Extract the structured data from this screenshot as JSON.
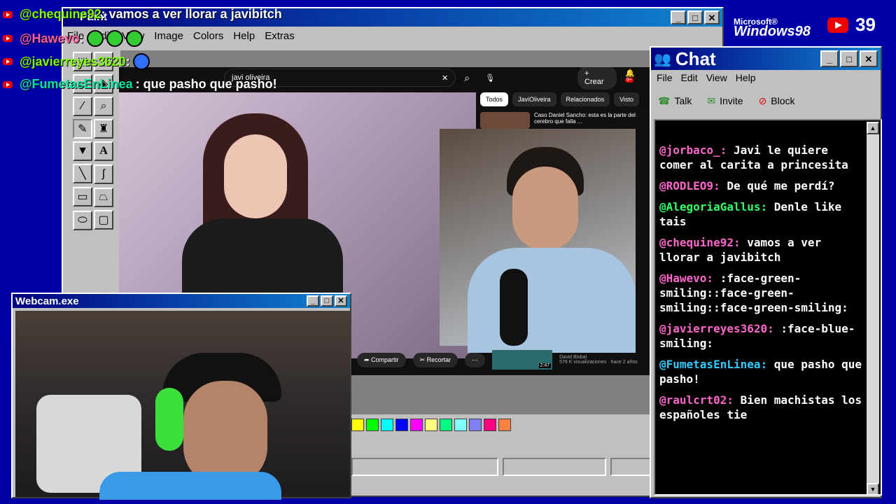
{
  "overlay_chat": [
    {
      "user": "@chequine92",
      "text": ": vamos a ver llorar a javibitch",
      "color": "#7cfc00"
    },
    {
      "user": "@Hawevo",
      "text": ":",
      "color": "#ff5fa0"
    },
    {
      "user": "@javierreyes3620",
      "text": ":",
      "color": "#7cfc00"
    },
    {
      "user": "@FumetasEnLinea",
      "text": ": que pasho que pasho!",
      "color": "#00e5a0"
    }
  ],
  "paint": {
    "title": "Paint",
    "menu": [
      "File",
      "Edit",
      "View",
      "Image",
      "Colors",
      "Help",
      "Extras"
    ],
    "palette": [
      "#ffff00",
      "#00ff00",
      "#00ffff",
      "#0000ff",
      "#ff00ff",
      "#ffff80",
      "#00ff80",
      "#80ffff",
      "#8080ff",
      "#ff0080",
      "#ff8040"
    ]
  },
  "youtube": {
    "search": "javi oliveira",
    "create": "Crear",
    "chips": [
      "Todos",
      "JaviOliveira",
      "Relacionados",
      "Visto"
    ],
    "rec_title": "Caso Daniel Sancho: esta es la parte del cerebro que falla ...",
    "share": "Compartir",
    "clip": "Recortar",
    "channel": "David Bisbal",
    "views": "576 K visualizaciones · hace 2 años",
    "duration": "2:47",
    "notif": "9+"
  },
  "webcam": {
    "title": "Webcam.exe"
  },
  "chat": {
    "title": "Chat",
    "menu": [
      "File",
      "Edit",
      "View",
      "Help"
    ],
    "tools": [
      "Talk",
      "Invite",
      "Block"
    ],
    "messages": [
      {
        "user": "@jorbaco_:",
        "text": "Javi le quiere comer al carita a princesita",
        "color": "#ff66cc"
      },
      {
        "user": "@RODLEO9:",
        "text": "De qué me perdí?",
        "color": "#ff66cc"
      },
      {
        "user": "@AlegoriaGallus:",
        "text": "Denle like tais",
        "color": "#33ff66"
      },
      {
        "user": "@chequine92:",
        "text": "vamos a ver llorar a javibitch",
        "color": "#ff66cc"
      },
      {
        "user": "@Hawevo:",
        "text": ":face-green-smiling::face-green-smiling::face-green-smiling:",
        "color": "#ff66cc"
      },
      {
        "user": "@javierreyes3620:",
        "text": ":face-blue-smiling:",
        "color": "#ff66cc"
      },
      {
        "user": "@FumetasEnLinea:",
        "text": "que pasho que pasho!",
        "color": "#33ccff"
      },
      {
        "user": "@raulcrt02:",
        "text": "Bien machistas los españoles tie",
        "color": "#ff66cc"
      }
    ]
  },
  "branding": {
    "ms": "Microsoft®",
    "win": "Windows98",
    "viewers": "39"
  }
}
